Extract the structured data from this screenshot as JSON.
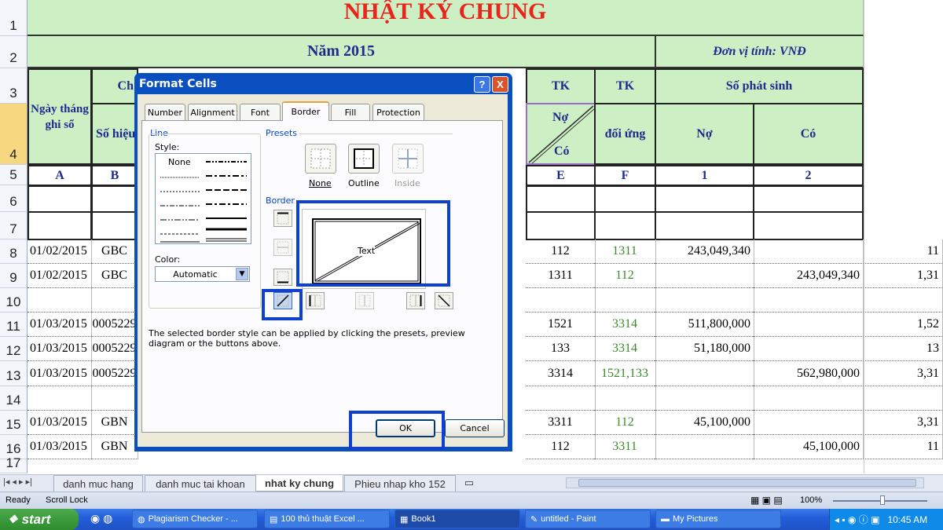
{
  "sheet": {
    "title": "NHẬT KÝ CHUNG",
    "year": "Năm 2015",
    "unit": "Đơn vị tính: VNĐ",
    "headers": {
      "date": "Ngày tháng ghi sổ",
      "chung_tu": "Ch",
      "so_hieu": "Số hiệu",
      "tk1": "TK",
      "tk2": "TK",
      "no_co_top": "Nợ",
      "no_co_bottom": "Có",
      "doi_ung": "đối ứng",
      "so_phat_sinh": "Số phát sinh",
      "no": "Nợ",
      "co": "Có"
    },
    "letters": {
      "A": "A",
      "B": "B",
      "E": "E",
      "F": "F",
      "one": "1",
      "two": "2"
    },
    "row_numbers": [
      "1",
      "2",
      "3",
      "4",
      "5",
      "6",
      "7",
      "8",
      "9",
      "10",
      "11",
      "12",
      "13",
      "14",
      "15",
      "16",
      "17"
    ],
    "rows": [
      {
        "date": "01/02/2015",
        "code": "GBC",
        "tk": "112",
        "du": "1311",
        "no": "243,049,340",
        "co": "",
        "extra": "11"
      },
      {
        "date": "01/02/2015",
        "code": "GBC",
        "tk": "1311",
        "du": "112",
        "no": "",
        "co": "243,049,340",
        "extra": "1,31"
      },
      {
        "date": "",
        "code": "",
        "tk": "",
        "du": "",
        "no": "",
        "co": "",
        "extra": ""
      },
      {
        "date": "01/03/2015",
        "code": "0005229",
        "tk": "1521",
        "du": "3314",
        "no": "511,800,000",
        "co": "",
        "extra": "1,52"
      },
      {
        "date": "01/03/2015",
        "code": "0005229",
        "tk": "133",
        "du": "3314",
        "no": "51,180,000",
        "co": "",
        "extra": "13"
      },
      {
        "date": "01/03/2015",
        "code": "0005229",
        "tk": "3314",
        "du": "1521,133",
        "no": "",
        "co": "562,980,000",
        "extra": "3,31"
      },
      {
        "date": "",
        "code": "",
        "tk": "",
        "du": "",
        "no": "",
        "co": "",
        "extra": ""
      },
      {
        "date": "01/03/2015",
        "code": "GBN",
        "tk": "3311",
        "du": "112",
        "no": "45,100,000",
        "co": "",
        "extra": "3,31"
      },
      {
        "date": "01/03/2015",
        "code": "GBN",
        "tk": "112",
        "du": "3311",
        "no": "",
        "co": "45,100,000",
        "extra": "11"
      }
    ]
  },
  "dialog": {
    "title": "Format Cells",
    "help": "?",
    "close": "X",
    "tabs": [
      "Number",
      "Alignment",
      "Font",
      "Border",
      "Fill",
      "Protection"
    ],
    "active_tab": "Border",
    "line_label": "Line",
    "style_label": "Style:",
    "none_style": "None",
    "color_label": "Color:",
    "color_value": "Automatic",
    "presets_label": "Presets",
    "preset_none": "None",
    "preset_outline": "Outline",
    "preset_inside": "Inside",
    "border_label": "Border",
    "preview_text": "Text",
    "hint": "The selected border style can be applied by clicking the presets, preview diagram or the buttons above.",
    "ok": "OK",
    "cancel": "Cancel"
  },
  "sheet_tabs": [
    "danh muc hang",
    "danh muc tai khoan",
    "nhat ky chung",
    "Phieu nhap kho 152"
  ],
  "active_sheet": "nhat ky chung",
  "status": {
    "ready": "Ready",
    "scroll_lock": "Scroll Lock",
    "zoom": "100%"
  },
  "taskbar": {
    "start": "start",
    "items": [
      "Plagiarism Checker - ...",
      "100 thủ thuật Excel ...",
      "Book1",
      "untitled - Paint",
      "My Pictures"
    ],
    "clock": "10:45 AM"
  },
  "colors": {
    "header_green": "#ccf0c4",
    "title_red": "#e8241c",
    "header_blue": "#1d2b8f",
    "dialog_blue": "#0a4fc0",
    "highlight": "#1040d0",
    "taskbar": "#245edb"
  }
}
